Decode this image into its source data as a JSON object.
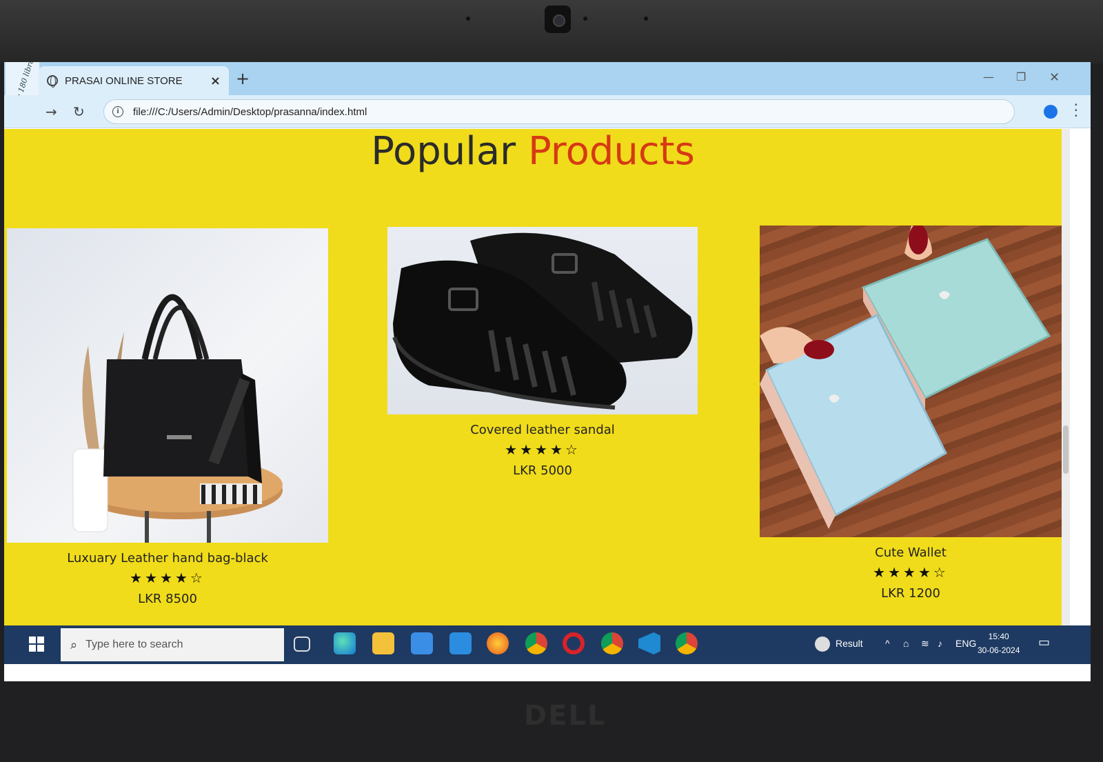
{
  "browser": {
    "tab_title": "PRASAI ONLINE STORE",
    "tab_close": "×",
    "new_tab": "+",
    "url": "file:///C:/Users/Admin/Desktop/prasanna/index.html",
    "handwritten_note": "by the 180 library"
  },
  "page": {
    "heading_main": "Popular",
    "heading_accent": "Products",
    "accent_color": "#d63a14",
    "background_color": "#f0dc1a",
    "products": [
      {
        "name": "Luxuary Leather hand bag-black",
        "stars": "★★★★☆",
        "rating": 4,
        "price": "LKR 8500",
        "image": "black-handbag"
      },
      {
        "name": "Covered leather sandal",
        "stars": "★★★★☆",
        "rating": 4,
        "price": "LKR 5000",
        "image": "black-leather-sandal"
      },
      {
        "name": "Cute Wallet",
        "stars": "★★★★☆",
        "rating": 4,
        "price": "LKR 1200",
        "image": "blue-wallet"
      }
    ]
  },
  "taskbar": {
    "search_placeholder": "Type here to search",
    "weather_label": "Result",
    "language": "ENG",
    "time": "15:40",
    "date": "30-06-2024"
  }
}
